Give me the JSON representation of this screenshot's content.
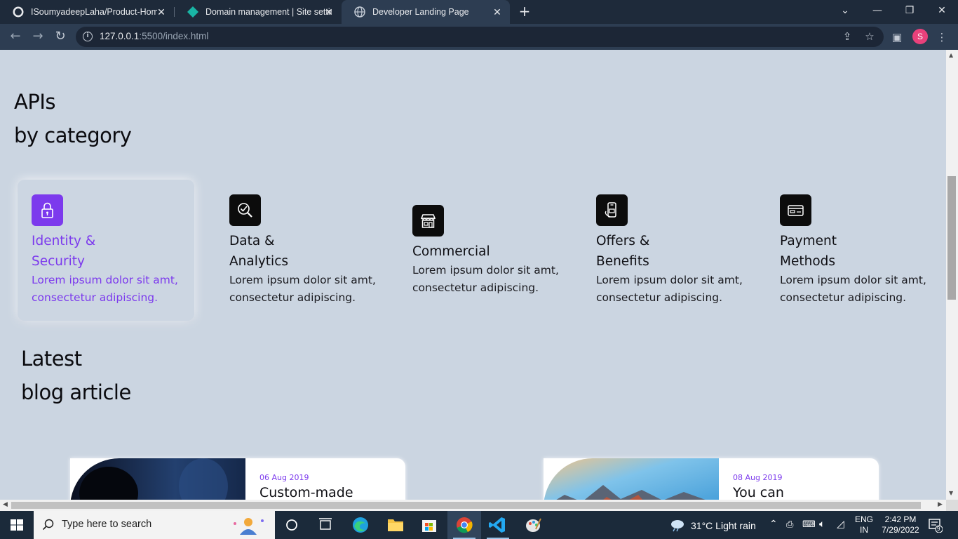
{
  "browser": {
    "tabs": [
      {
        "title": "ISoumyadeepLaha/Product-Hom",
        "icon": "github-icon",
        "active": false
      },
      {
        "title": "Domain management | Site settin",
        "icon": "netlify-icon",
        "active": false
      },
      {
        "title": "Developer Landing Page",
        "icon": "globe-icon",
        "active": true
      }
    ],
    "url_host": "127.0.0.1",
    "url_rest": ":5500/index.html",
    "profile_initial": "S"
  },
  "page": {
    "apis_heading_line1": "APIs",
    "apis_heading_line2": "by category",
    "categories": [
      {
        "title_line1": "Identity &",
        "title_line2": "Security",
        "desc_line1": "Lorem ipsum dolor sit amt,",
        "desc_line2": "consectetur adipiscing.",
        "icon": "lock-icon",
        "active": true
      },
      {
        "title_line1": "Data &",
        "title_line2": "Analytics",
        "desc_line1": "Lorem ipsum dolor sit amt,",
        "desc_line2": "consectetur adipiscing.",
        "icon": "magnifier-check-icon",
        "active": false
      },
      {
        "title_line1": "Commercial",
        "title_line2": "",
        "desc_line1": "Lorem ipsum dolor sit amt,",
        "desc_line2": "consectetur adipiscing.",
        "icon": "storefront-icon",
        "active": false
      },
      {
        "title_line1": "Offers &",
        "title_line2": "Benefits",
        "desc_line1": "Lorem ipsum dolor sit amt,",
        "desc_line2": "consectetur adipiscing.",
        "icon": "phone-offer-icon",
        "active": false
      },
      {
        "title_line1": "Payment",
        "title_line2": "Methods",
        "desc_line1": "Lorem ipsum dolor sit amt,",
        "desc_line2": "consectetur adipiscing.",
        "icon": "credit-card-icon",
        "active": false
      }
    ],
    "blog_heading_line1": "Latest",
    "blog_heading_line2": "blog article",
    "blog_cards": [
      {
        "date": "06 Aug 2019",
        "title": "Custom-made"
      },
      {
        "date": "08 Aug 2019",
        "title": "You can"
      }
    ]
  },
  "taskbar": {
    "search_placeholder": "Type here to search",
    "weather": "31°C  Light rain",
    "lang_line1": "ENG",
    "lang_line2": "IN",
    "time": "2:42 PM",
    "date": "7/29/2022",
    "notification_count": "9"
  },
  "colors": {
    "accent": "#7c3aed",
    "page_bg": "#cbd5e1",
    "chrome_bg": "#1e2a3a",
    "toolbar_bg": "#2d3d52"
  }
}
